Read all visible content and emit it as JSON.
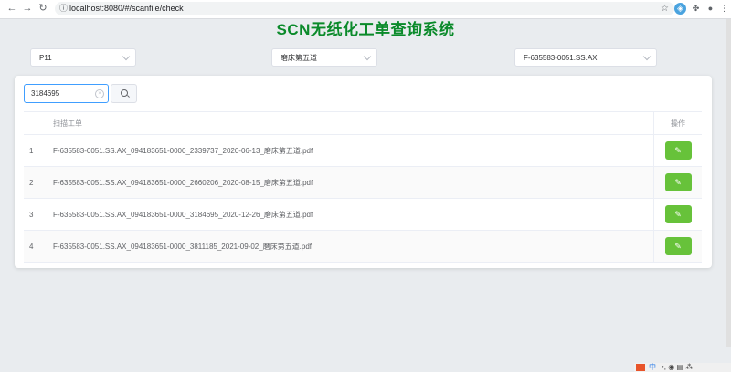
{
  "browser": {
    "url": "localhost:8080/#/scanfile/check",
    "back_icon": "←",
    "forward_icon": "→",
    "reload_icon": "↻"
  },
  "page": {
    "title": "SCN无纸化工单查询系统",
    "title_color": "#0a8a2a"
  },
  "filters": {
    "select1": {
      "value": "P11"
    },
    "select2": {
      "value": "磨床第五道"
    },
    "select3": {
      "value": "F-635583-0051.SS.AX"
    }
  },
  "search": {
    "value": "3184695",
    "clear_icon": "×"
  },
  "table": {
    "headers": {
      "index": "",
      "name": "扫描工单",
      "op": "操作"
    },
    "rows": [
      {
        "index": "1",
        "name": "F-635583-0051.SS.AX_094183651-0000_2339737_2020-06-13_磨床第五道.pdf"
      },
      {
        "index": "2",
        "name": "F-635583-0051.SS.AX_094183651-0000_2660206_2020-08-15_磨床第五道.pdf"
      },
      {
        "index": "3",
        "name": "F-635583-0051.SS.AX_094183651-0000_3184695_2020-12-26_磨床第五道.pdf"
      },
      {
        "index": "4",
        "name": "F-635583-0051.SS.AX_094183651-0000_3811185_2021-09-02_磨床第五道.pdf"
      }
    ],
    "edit_icon": "✎",
    "edit_color": "#67c23a"
  },
  "tray": {
    "ime_label": "中",
    "items": "•, ◉ ▤ ⁂"
  }
}
